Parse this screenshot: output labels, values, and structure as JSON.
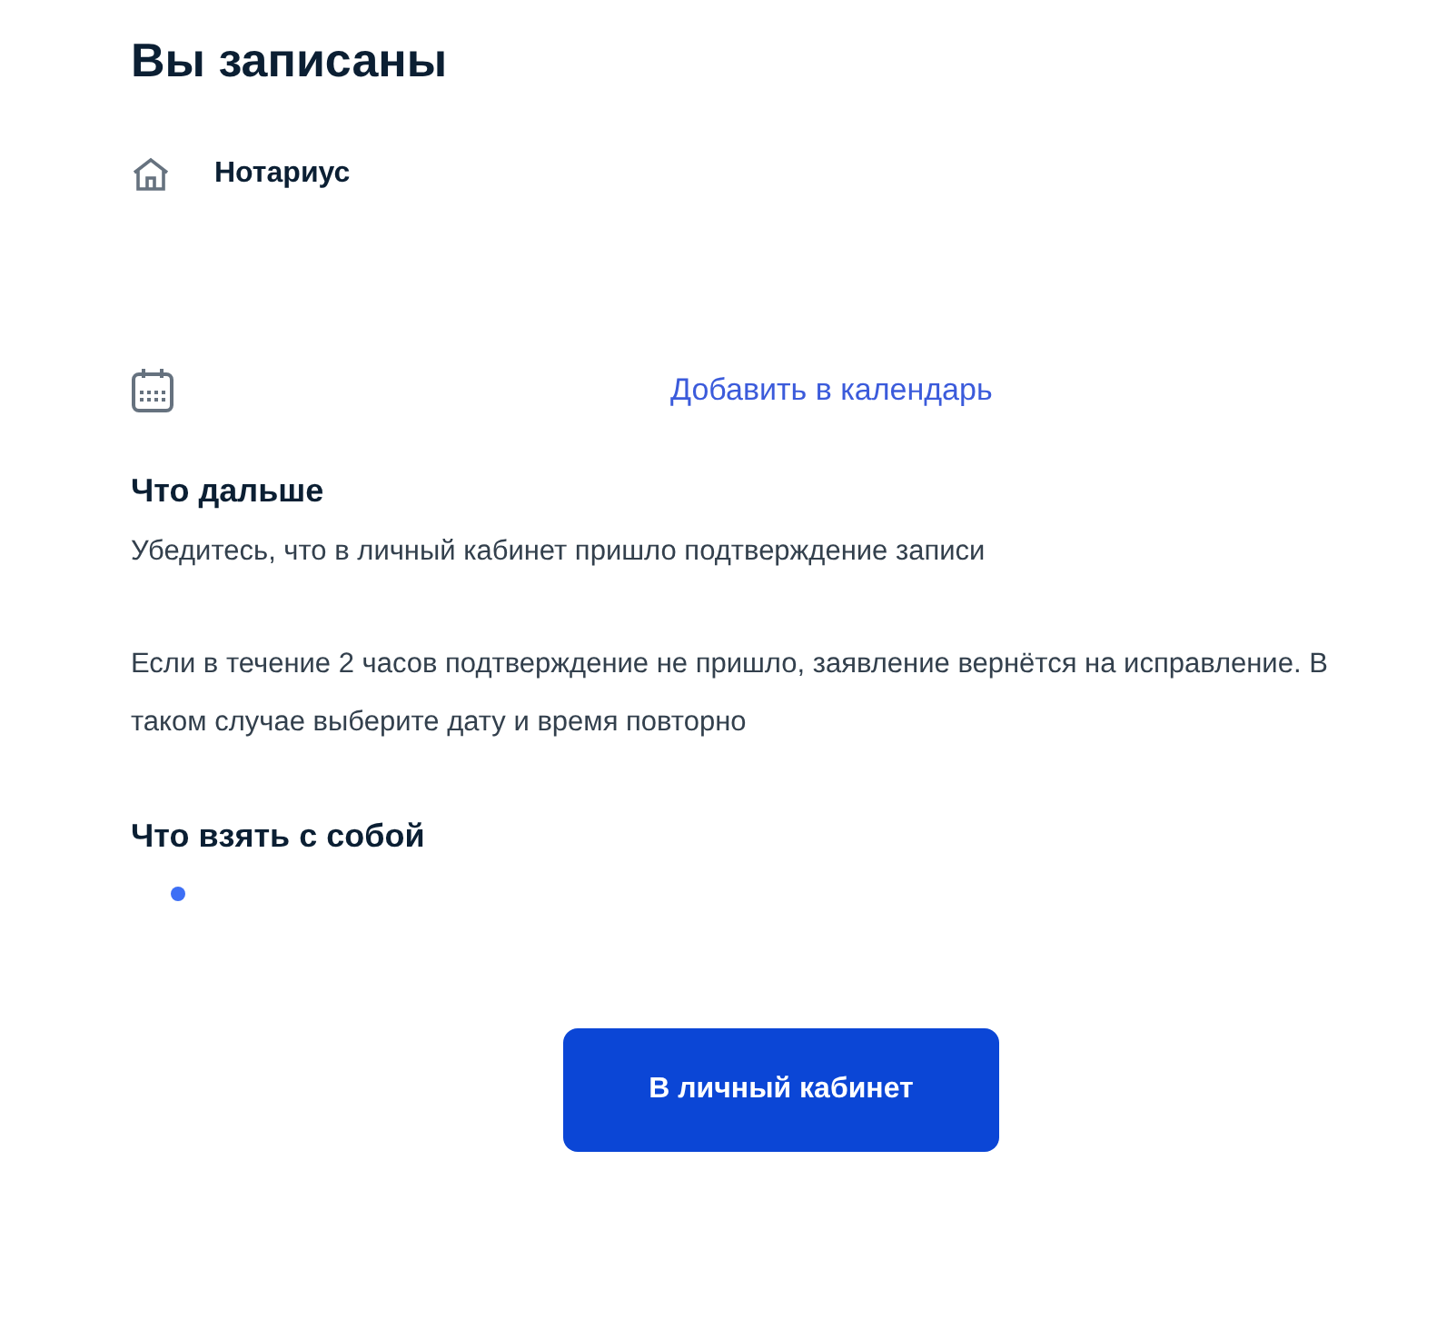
{
  "title": "Вы записаны",
  "service": {
    "label": "Нотариус"
  },
  "calendar": {
    "link": "Добавить в календарь"
  },
  "next_steps": {
    "title": "Что дальше",
    "paragraphs": [
      "Убедитесь, что в личный кабинет пришло подтверждение записи",
      "Если в течение 2 часов подтверждение не пришло, заявление вернётся на исправление. В таком случае выберите дату и время повторно"
    ]
  },
  "what_to_bring": {
    "title": "Что взять с собой",
    "items": [
      {
        "kind": "bullet"
      }
    ]
  },
  "button": {
    "label": "В личный кабинет"
  }
}
